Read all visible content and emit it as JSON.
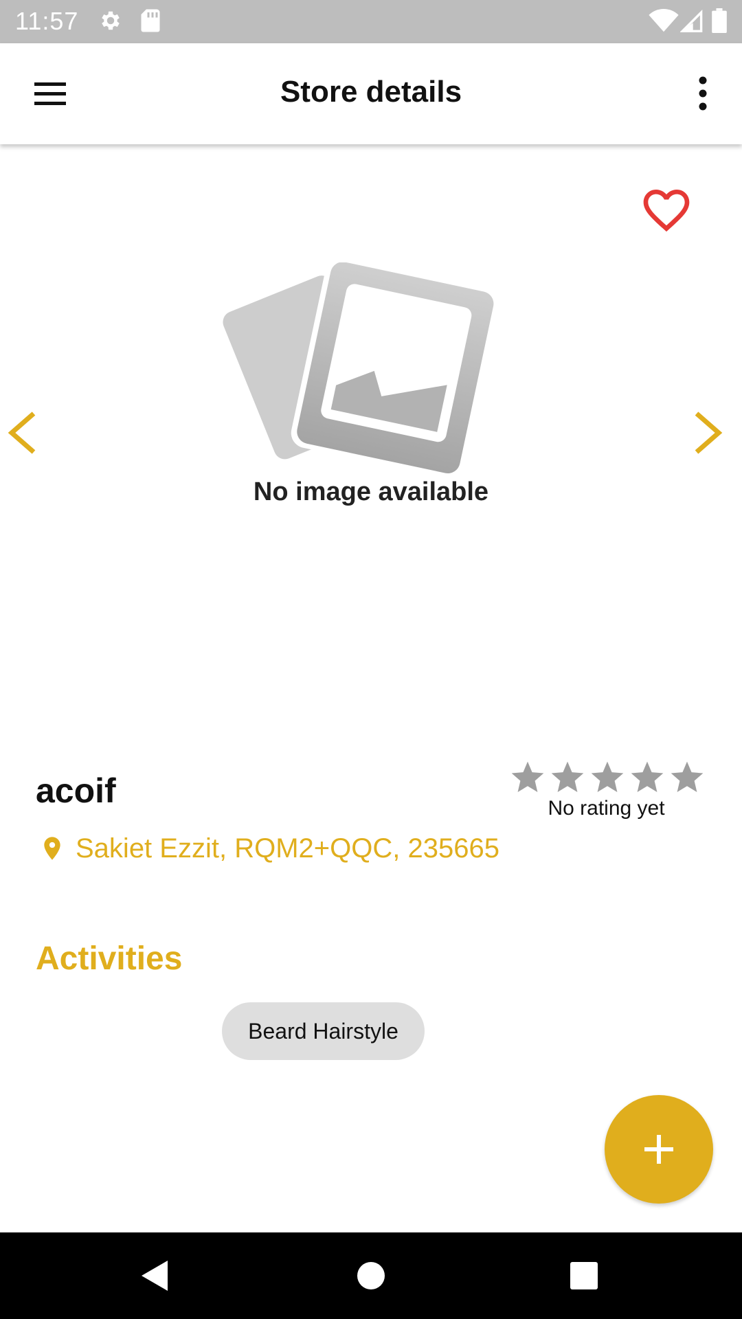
{
  "status_bar": {
    "time": "11:57",
    "icons": [
      "settings-icon",
      "sd-card-icon",
      "wifi-icon",
      "cell-signal-icon",
      "battery-icon"
    ]
  },
  "app_bar": {
    "title": "Store details",
    "menu_icon": "hamburger-menu-icon",
    "more_icon": "more-vert-icon"
  },
  "carousel": {
    "no_image_text": "No image available",
    "prev_icon": "chevron-left-icon",
    "next_icon": "chevron-right-icon"
  },
  "store": {
    "name": "acoif",
    "address": "Sakiet Ezzit, RQM2+QQC, 235665",
    "rating_text": "No rating yet",
    "rating_stars_total": 5,
    "rating_value": 0,
    "favorite": false
  },
  "activities": {
    "title": "Activities",
    "items": [
      "Beard Hairstyle"
    ]
  },
  "fab": {
    "icon": "plus-icon"
  },
  "colors": {
    "accent": "#e0ae1d",
    "favorite": "#e53935",
    "star_inactive": "#9e9e9e",
    "chip_bg": "#dedede",
    "status_bar": "#bdbdbd",
    "nav_bar": "#000000"
  }
}
